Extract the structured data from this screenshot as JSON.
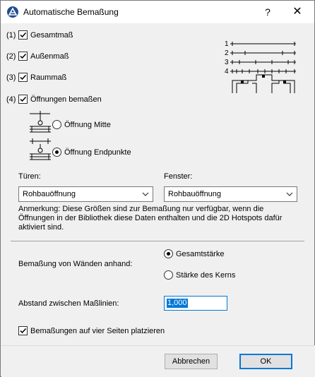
{
  "window": {
    "title": "Automatische Bemaßung",
    "help": "?",
    "close": "✕"
  },
  "options": {
    "items": [
      {
        "num": "(1)",
        "label": "Gesamtmaß",
        "checked": true
      },
      {
        "num": "(2)",
        "label": "Außenmaß",
        "checked": true
      },
      {
        "num": "(3)",
        "label": "Raummaß",
        "checked": true
      },
      {
        "num": "(4)",
        "label": "Öffnungen bemaßen",
        "checked": true
      }
    ],
    "preview_numbers": [
      "1",
      "2",
      "3",
      "4"
    ]
  },
  "opening": {
    "mid_label": "Öffnung Mitte",
    "ends_label": "Öffnung Endpunkte",
    "selected": "ends"
  },
  "doors": {
    "label": "Türen:",
    "value": "Rohbauöffnung"
  },
  "windows": {
    "label": "Fenster:",
    "value": "Rohbauöffnung"
  },
  "note": "Anmerkung: Diese Größen sind zur Bemaßung nur verfügbar, wenn die Öffnungen in der Bibliothek diese Daten enthalten und die 2D Hotspots dafür aktiviert sind.",
  "walls": {
    "label": "Bemaßung von Wänden anhand:",
    "option_total": "Gesamtstärke",
    "option_core": "Stärke des Kerns",
    "selected": "total"
  },
  "spacing": {
    "label": "Abstand zwischen Maßlinien:",
    "value": "1,000"
  },
  "four_sides": {
    "label": "Bemaßungen auf vier Seiten platzieren",
    "checked": true
  },
  "buttons": {
    "cancel": "Abbrechen",
    "ok": "OK"
  },
  "colors": {
    "accent": "#0078d7",
    "dialog_bg": "#f0f0f0"
  }
}
